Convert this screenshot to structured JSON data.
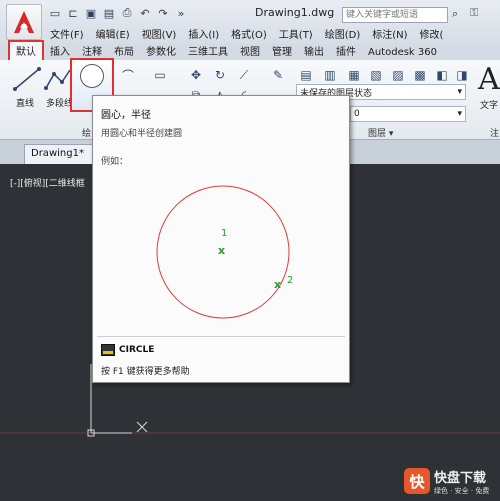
{
  "window": {
    "doc_title": "Drawing1.dwg",
    "search_placeholder": "键入关键字或短语"
  },
  "menu": [
    "文件(F)",
    "编辑(E)",
    "视图(V)",
    "插入(I)",
    "格式(O)",
    "工具(T)",
    "绘图(D)",
    "标注(N)",
    "修改("
  ],
  "ribbon_tabs": [
    "默认",
    "插入",
    "注释",
    "布局",
    "参数化",
    "三维工具",
    "视图",
    "管理",
    "输出",
    "插件",
    "Autodesk 360"
  ],
  "ribbon": {
    "line_label": "直线",
    "polyline_label": "多段线",
    "draw_panel": "绘",
    "layer_state": "未保存的图层状态",
    "layer_value": "0",
    "layer_panel": "图层 ▾",
    "text_label": "文字",
    "annot_panel": "注"
  },
  "file_tab": "Drawing1*",
  "viewport_label": "[-][俯视][二维线框",
  "tooltip": {
    "title": "圆心，半径",
    "description": "用圆心和半径创建圆",
    "example_label": "例如：",
    "point1": "1",
    "point2": "2",
    "point_marker": "x",
    "command": "CIRCLE",
    "help": "按 F1 键获得更多帮助"
  },
  "watermark": {
    "brand": "快盘下载",
    "sub": "绿色 · 安全 · 免费"
  },
  "colors": {
    "circle_stroke": "#e03a3a",
    "point_color": "#2aa12a",
    "highlight": "#e03030",
    "canvas_bg": "#2e3136"
  }
}
